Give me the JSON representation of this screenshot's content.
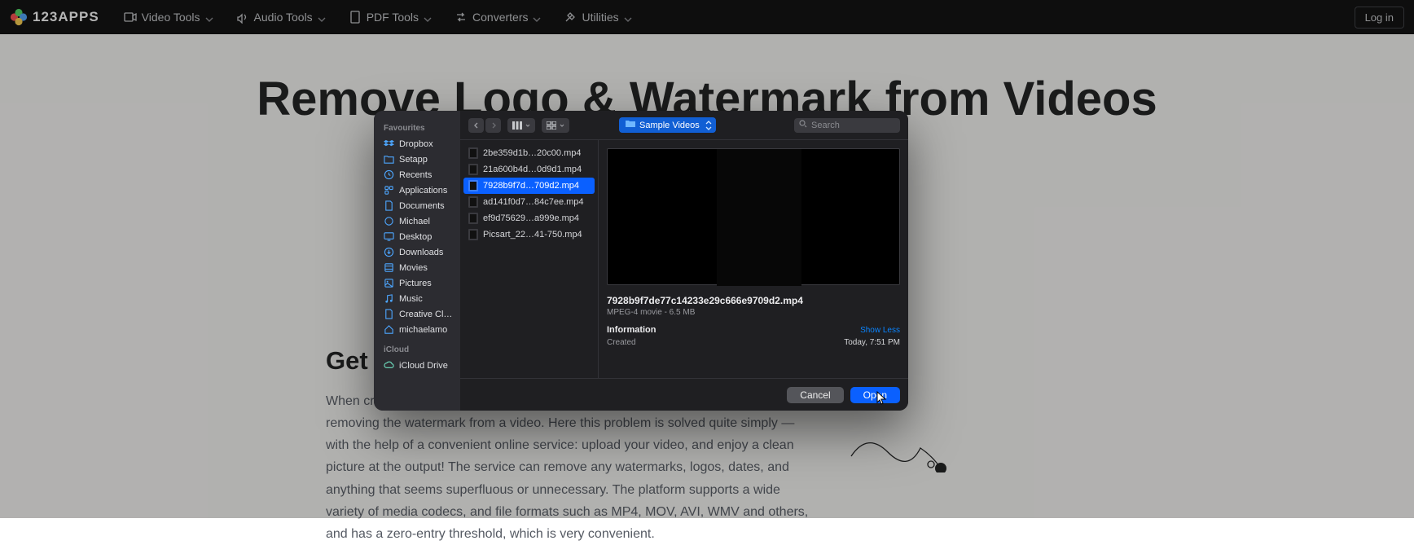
{
  "nav": {
    "brand": "123APPS",
    "items": [
      {
        "label": "Video Tools"
      },
      {
        "label": "Audio Tools"
      },
      {
        "label": "PDF Tools"
      },
      {
        "label": "Converters"
      },
      {
        "label": "Utilities"
      }
    ],
    "login": "Log in"
  },
  "page": {
    "hero_title": "Remove Logo & Watermark from Videos",
    "section_title": "Get rid",
    "section_body": "When creating a video, one of the most common questions a person faces is removing the watermark from a video. Here this problem is solved quite simply — with the help of a convenient online service: upload your video, and enjoy a clean picture at the output! The service can remove any watermarks, logos, dates, and anything that seems superfluous or unnecessary. The platform supports a wide variety of media codecs, and file formats such as MP4, MOV, AVI, WMV and others, and has a zero-entry threshold, which is very convenient."
  },
  "dialog": {
    "sidebar": {
      "fav_header": "Favourites",
      "fav_items": [
        {
          "label": "Dropbox",
          "icon": "dropbox-icon"
        },
        {
          "label": "Setapp",
          "icon": "folder-icon"
        },
        {
          "label": "Recents",
          "icon": "clock-icon"
        },
        {
          "label": "Applications",
          "icon": "apps-icon"
        },
        {
          "label": "Documents",
          "icon": "doc-icon"
        },
        {
          "label": "Michael",
          "icon": "circle-icon"
        },
        {
          "label": "Desktop",
          "icon": "desktop-icon"
        },
        {
          "label": "Downloads",
          "icon": "download-icon"
        },
        {
          "label": "Movies",
          "icon": "movies-icon"
        },
        {
          "label": "Pictures",
          "icon": "pictures-icon"
        },
        {
          "label": "Music",
          "icon": "music-icon"
        },
        {
          "label": "Creative Cl…",
          "icon": "doc-icon"
        },
        {
          "label": "michaelamo",
          "icon": "home-icon"
        }
      ],
      "icloud_header": "iCloud",
      "icloud_items": [
        {
          "label": "iCloud Drive",
          "icon": "cloud-icon"
        }
      ]
    },
    "toolbar": {
      "location": "Sample Videos",
      "search_placeholder": "Search"
    },
    "files": [
      {
        "name": "2be359d1b…20c00.mp4",
        "selected": false
      },
      {
        "name": "21a600b4d…0d9d1.mp4",
        "selected": false
      },
      {
        "name": "7928b9f7d…709d2.mp4",
        "selected": true
      },
      {
        "name": "ad141f0d7…84c7ee.mp4",
        "selected": false
      },
      {
        "name": "ef9d75629…a999e.mp4",
        "selected": false
      },
      {
        "name": "Picsart_22…41-750.mp4",
        "selected": false
      }
    ],
    "preview": {
      "filename": "7928b9f7de77c14233e29c666e9709d2.mp4",
      "desc": "MPEG-4 movie - 6.5 MB",
      "info_label": "Information",
      "show_less": "Show Less",
      "created_label": "Created",
      "created_value": "Today, 7:51 PM"
    },
    "footer": {
      "cancel": "Cancel",
      "open": "Open"
    }
  }
}
